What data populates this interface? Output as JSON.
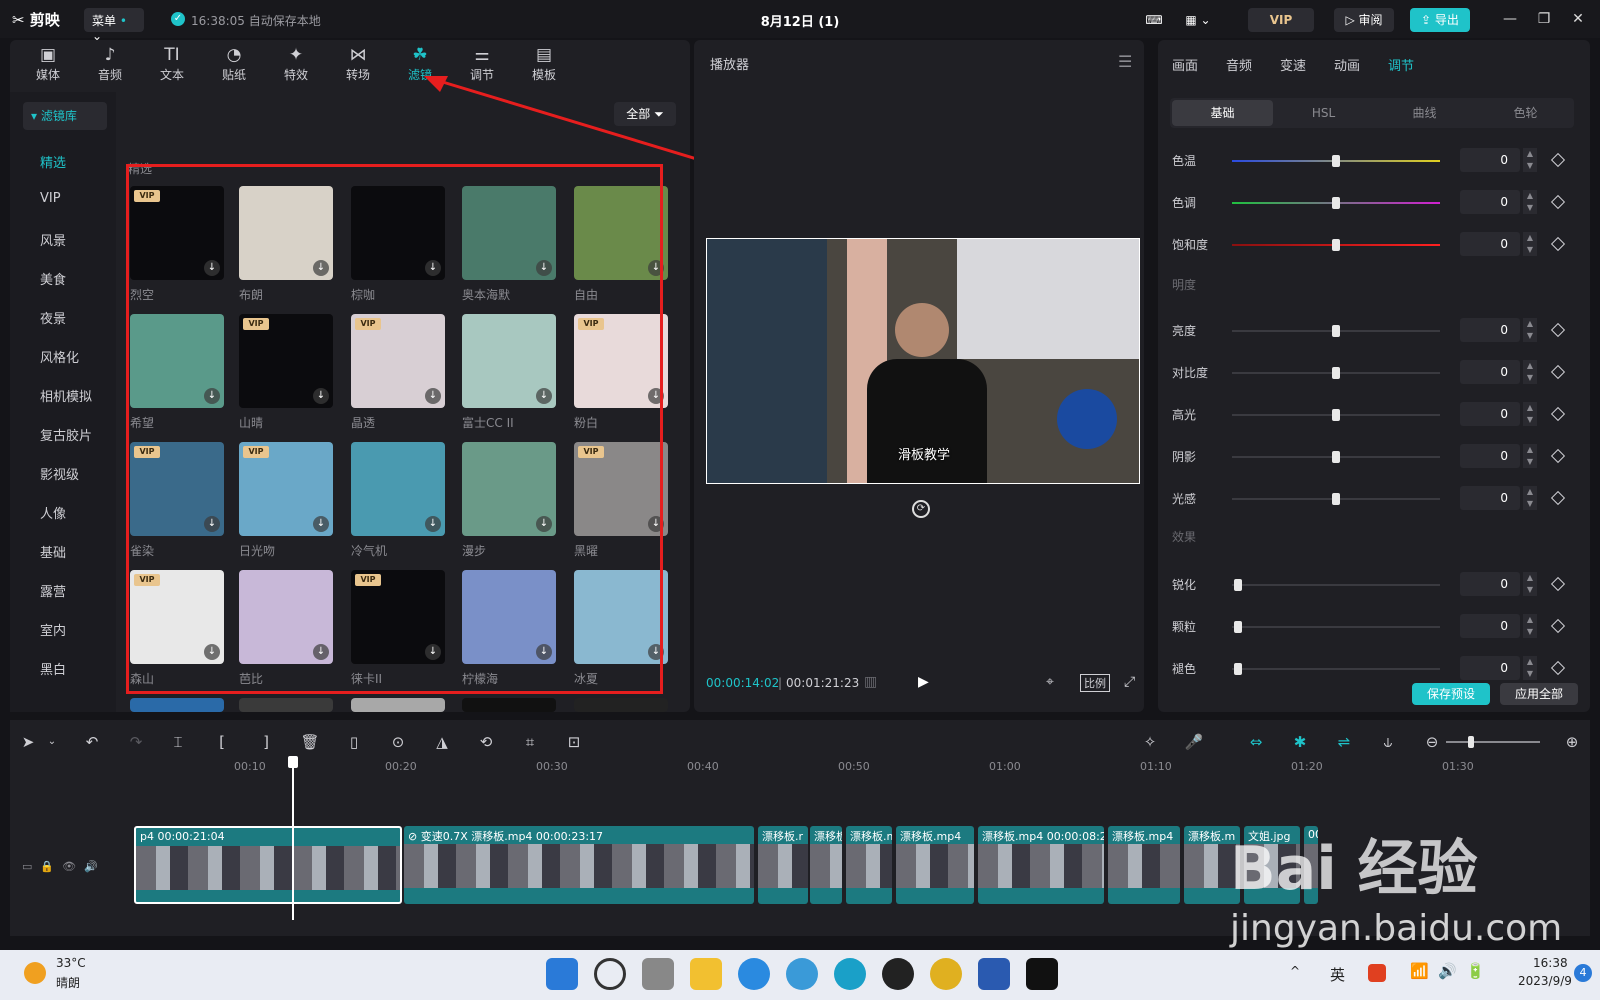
{
  "titlebar": {
    "app_name": "剪映",
    "menu_label": "菜单",
    "autosave_text": "16:38:05 自动保存本地",
    "project_title": "8月12日 (1)",
    "vip_label": "VIP",
    "review_label": "审阅",
    "export_label": "导出"
  },
  "tool_tabs": [
    {
      "label": "媒体",
      "icon": "▣"
    },
    {
      "label": "音频",
      "icon": "♪"
    },
    {
      "label": "文本",
      "icon": "TI"
    },
    {
      "label": "贴纸",
      "icon": "◔"
    },
    {
      "label": "特效",
      "icon": "✦"
    },
    {
      "label": "转场",
      "icon": "⋈"
    },
    {
      "label": "滤镜",
      "icon": "☘"
    },
    {
      "label": "调节",
      "icon": "⚌"
    },
    {
      "label": "模板",
      "icon": "▤"
    }
  ],
  "filters": {
    "library_label": "滤镜库",
    "categories": [
      "精选",
      "VIP",
      "风景",
      "美食",
      "夜景",
      "风格化",
      "相机模拟",
      "复古胶片",
      "影视级",
      "人像",
      "基础",
      "露营",
      "室内",
      "黑白"
    ],
    "filter_button": "全部",
    "section_label": "精选",
    "items": [
      {
        "name": "烈空",
        "vip": true,
        "color": "#0b0b0e"
      },
      {
        "name": "布朗",
        "vip": false,
        "color": "#d8d2c8"
      },
      {
        "name": "棕咖",
        "vip": false,
        "color": "#0b0b0e"
      },
      {
        "name": "奥本海默",
        "vip": false,
        "color": "#4a7a6a"
      },
      {
        "name": "自由",
        "vip": false,
        "color": "#6a8a4a"
      },
      {
        "name": "希望",
        "vip": false,
        "color": "#5a9a8a"
      },
      {
        "name": "山晴",
        "vip": true,
        "color": "#0b0b0e"
      },
      {
        "name": "晶透",
        "vip": true,
        "color": "#d8cfd4"
      },
      {
        "name": "富士CC II",
        "vip": false,
        "color": "#a8c8c0"
      },
      {
        "name": "粉白",
        "vip": true,
        "color": "#e8dada"
      },
      {
        "name": "雀染",
        "vip": true,
        "color": "#3a6a8a"
      },
      {
        "name": "日光吻",
        "vip": true,
        "color": "#6aa8c8"
      },
      {
        "name": "冷气机",
        "vip": false,
        "color": "#4a9ab0"
      },
      {
        "name": "漫步",
        "vip": false,
        "color": "#6a9a88"
      },
      {
        "name": "黑曜",
        "vip": true,
        "color": "#8a8888"
      },
      {
        "name": "森山",
        "vip": true,
        "color": "#e8e8e8"
      },
      {
        "name": "芭比",
        "vip": false,
        "color": "#c8b8d8"
      },
      {
        "name": "徕卡II",
        "vip": true,
        "color": "#0b0b0e"
      },
      {
        "name": "柠檬海",
        "vip": false,
        "color": "#7a90c8"
      },
      {
        "name": "冰夏",
        "vip": false,
        "color": "#8ab8d0"
      }
    ]
  },
  "player": {
    "title": "播放器",
    "subtitle": "滑板教学",
    "time_current": "00:00:14:02",
    "time_total": "00:01:21:23",
    "ratio_label": "比例"
  },
  "adjust": {
    "tabs": [
      "画面",
      "音频",
      "变速",
      "动画",
      "调节"
    ],
    "active_tab": "调节",
    "subtabs": [
      "基础",
      "HSL",
      "曲线",
      "色轮"
    ],
    "sliders_color": [
      {
        "label": "色温",
        "value": "0"
      },
      {
        "label": "色调",
        "value": "0"
      },
      {
        "label": "饱和度",
        "value": "0"
      }
    ],
    "section_light": "明度",
    "sliders_light": [
      {
        "label": "亮度",
        "value": "0"
      },
      {
        "label": "对比度",
        "value": "0"
      },
      {
        "label": "高光",
        "value": "0"
      },
      {
        "label": "阴影",
        "value": "0"
      },
      {
        "label": "光感",
        "value": "0"
      }
    ],
    "section_effect": "效果",
    "sliders_effect": [
      {
        "label": "锐化",
        "value": "0"
      },
      {
        "label": "颗粒",
        "value": "0"
      },
      {
        "label": "褪色",
        "value": "0"
      }
    ],
    "save_preset": "保存预设",
    "apply_all": "应用全部"
  },
  "timeline": {
    "ticks": [
      "00:10",
      "00:20",
      "00:30",
      "00:40",
      "00:50",
      "01:00",
      "01:10",
      "01:20",
      "01:30"
    ],
    "clips": [
      {
        "label": "p4  00:00:21:04"
      },
      {
        "label": "⊘ 变速0.7X  漂移板.mp4  00:00:23:17"
      },
      {
        "label": "漂移板.r"
      },
      {
        "label": "漂移板"
      },
      {
        "label": "漂移板.m"
      },
      {
        "label": "漂移板.mp4"
      },
      {
        "label": "漂移板.mp4  00:00:08:2"
      },
      {
        "label": "漂移板.mp4"
      },
      {
        "label": "漂移板.m"
      },
      {
        "label": "文姐.jpg"
      },
      {
        "label": "00"
      }
    ]
  },
  "taskbar": {
    "temperature": "33°C",
    "weather": "晴朗",
    "ime": "英",
    "time": "16:38",
    "date": "2023/9/9",
    "notification_count": "4"
  },
  "watermark": {
    "brand": "Bai 经验",
    "url": "jingyan.baidu.com"
  },
  "colors": {
    "accent": "#1fc3c9",
    "annotation": "#e61e1e",
    "vip_gold": "#e9c58e"
  }
}
